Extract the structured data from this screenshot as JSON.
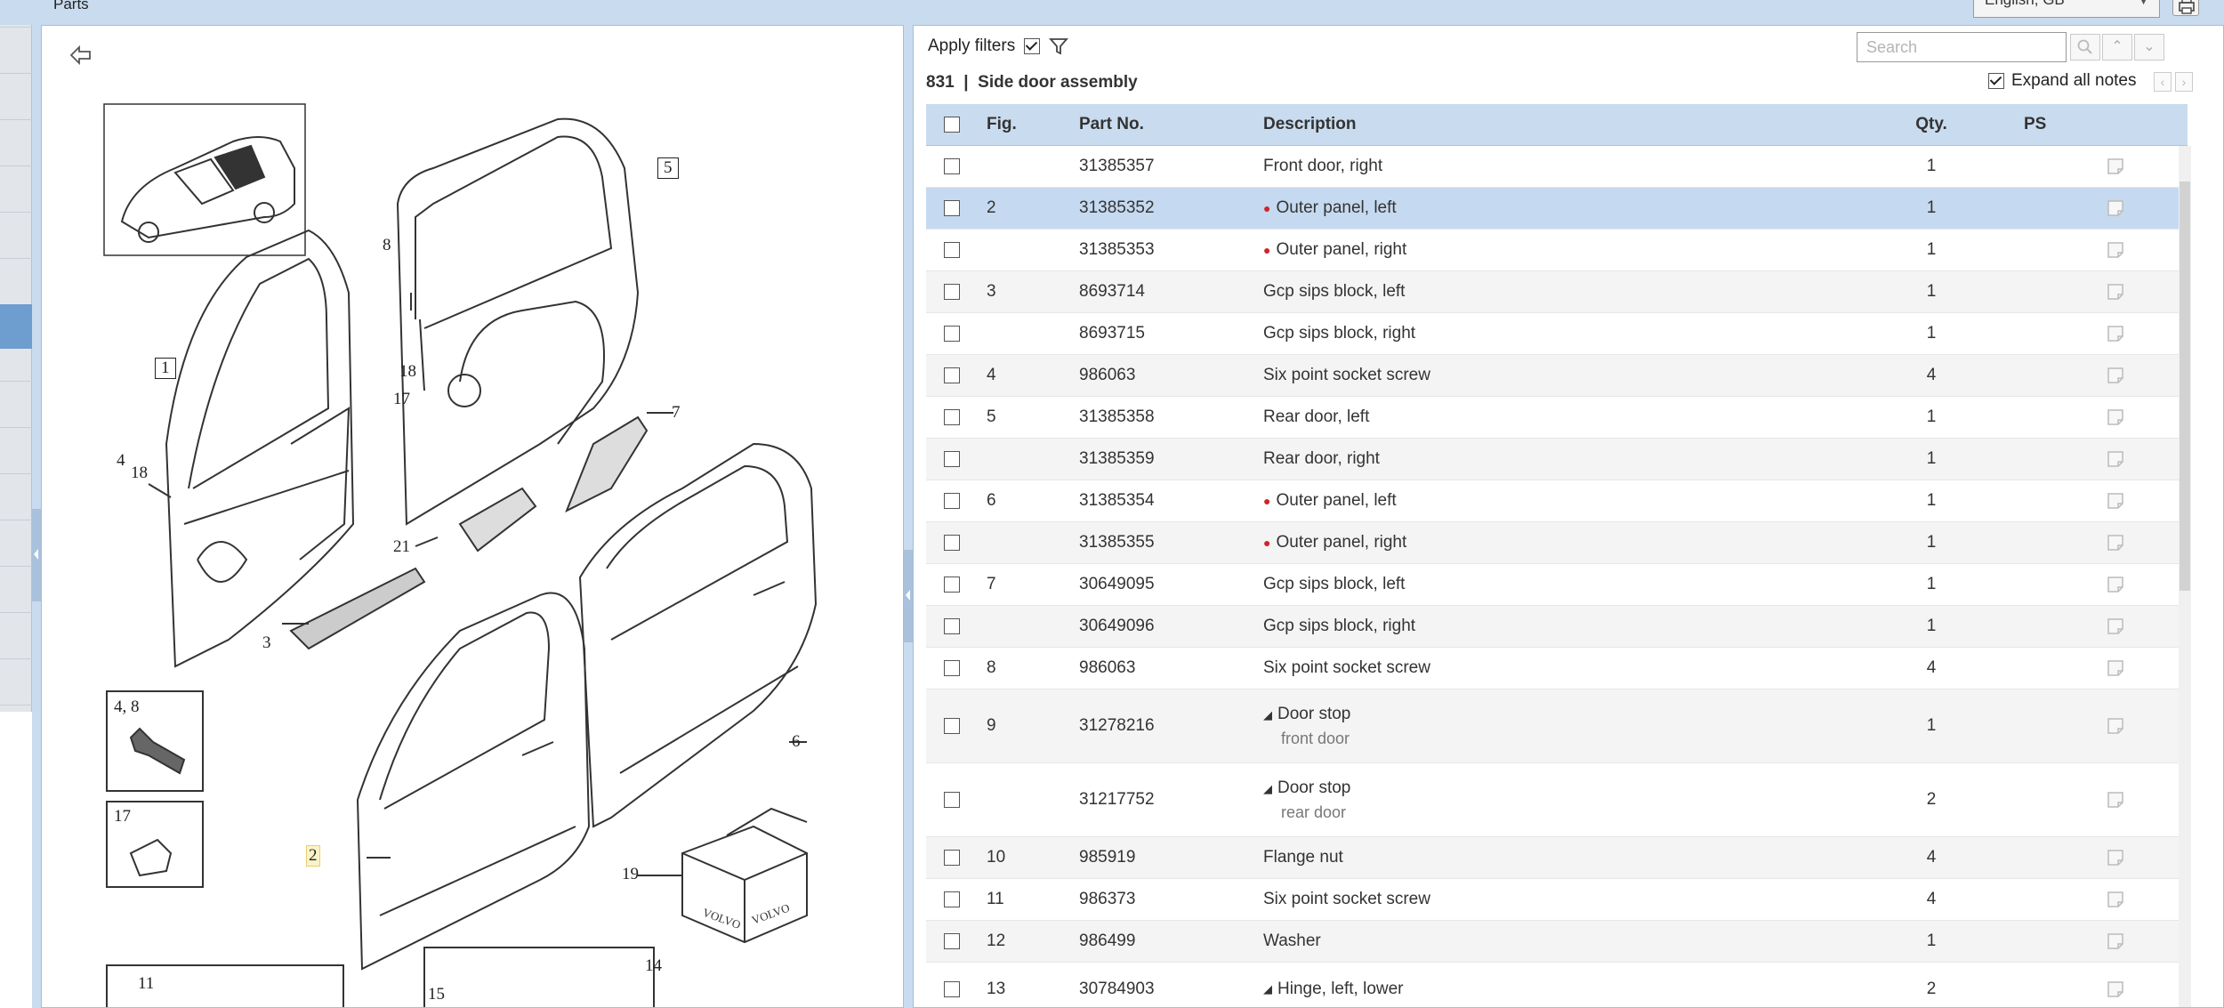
{
  "header": {
    "title": "Parts",
    "language": "English, GB"
  },
  "illustration": {
    "callouts": [
      {
        "id": "c1",
        "text": "1"
      },
      {
        "id": "c2",
        "text": "2"
      },
      {
        "id": "c3",
        "text": "3"
      },
      {
        "id": "c4",
        "text": "4"
      },
      {
        "id": "c5",
        "text": "5"
      },
      {
        "id": "c6",
        "text": "6"
      },
      {
        "id": "c7",
        "text": "7"
      },
      {
        "id": "c8",
        "text": "8"
      },
      {
        "id": "c11",
        "text": "11"
      },
      {
        "id": "c14",
        "text": "14"
      },
      {
        "id": "c15",
        "text": "15"
      },
      {
        "id": "c17a",
        "text": "17"
      },
      {
        "id": "c17b",
        "text": "17"
      },
      {
        "id": "c18a",
        "text": "18"
      },
      {
        "id": "c18b",
        "text": "18"
      },
      {
        "id": "c19",
        "text": "19"
      },
      {
        "id": "c21",
        "text": "21"
      },
      {
        "id": "c48",
        "text": "4, 8"
      }
    ],
    "box_text": "VOLVO"
  },
  "parts_panel": {
    "apply_filters_label": "Apply filters",
    "apply_filters_checked": true,
    "search_placeholder": "Search",
    "assembly_code": "831",
    "assembly_separator": "|",
    "assembly_name": "Side door assembly",
    "expand_notes_label": "Expand all notes",
    "expand_notes_checked": true,
    "columns": {
      "fig": "Fig.",
      "part_no": "Part No.",
      "description": "Description",
      "qty": "Qty.",
      "ps": "PS"
    },
    "rows": [
      {
        "fig": "",
        "part": "31385357",
        "desc": "Front door, right",
        "qty": "1",
        "bullet": false
      },
      {
        "fig": "2",
        "part": "31385352",
        "desc": "Outer panel, left",
        "qty": "1",
        "bullet": true,
        "selected": true
      },
      {
        "fig": "",
        "part": "31385353",
        "desc": "Outer panel, right",
        "qty": "1",
        "bullet": true
      },
      {
        "fig": "3",
        "part": "8693714",
        "desc": "Gcp sips block, left",
        "qty": "1",
        "bullet": false
      },
      {
        "fig": "",
        "part": "8693715",
        "desc": "Gcp sips block, right",
        "qty": "1",
        "bullet": false
      },
      {
        "fig": "4",
        "part": "986063",
        "desc": "Six point socket screw",
        "qty": "4",
        "bullet": false
      },
      {
        "fig": "5",
        "part": "31385358",
        "desc": "Rear door, left",
        "qty": "1",
        "bullet": false
      },
      {
        "fig": "",
        "part": "31385359",
        "desc": "Rear door, right",
        "qty": "1",
        "bullet": false
      },
      {
        "fig": "6",
        "part": "31385354",
        "desc": "Outer panel, left",
        "qty": "1",
        "bullet": true
      },
      {
        "fig": "",
        "part": "31385355",
        "desc": "Outer panel, right",
        "qty": "1",
        "bullet": true
      },
      {
        "fig": "7",
        "part": "30649095",
        "desc": "Gcp sips block, left",
        "qty": "1",
        "bullet": false
      },
      {
        "fig": "",
        "part": "30649096",
        "desc": "Gcp sips block, right",
        "qty": "1",
        "bullet": false
      },
      {
        "fig": "8",
        "part": "986063",
        "desc": "Six point socket screw",
        "qty": "4",
        "bullet": false
      },
      {
        "fig": "9",
        "part": "31278216",
        "desc": "Door stop",
        "sub": "front door",
        "qty": "1",
        "tri": true
      },
      {
        "fig": "",
        "part": "31217752",
        "desc": "Door stop",
        "sub": "rear door",
        "qty": "2",
        "tri": true
      },
      {
        "fig": "10",
        "part": "985919",
        "desc": "Flange nut",
        "qty": "4",
        "bullet": false
      },
      {
        "fig": "11",
        "part": "986373",
        "desc": "Six point socket screw",
        "qty": "4",
        "bullet": false
      },
      {
        "fig": "12",
        "part": "986499",
        "desc": "Washer",
        "qty": "1",
        "bullet": false
      },
      {
        "fig": "13",
        "part": "30784903",
        "desc": "Hinge, left, lower",
        "qty": "2",
        "tri": true
      }
    ]
  }
}
